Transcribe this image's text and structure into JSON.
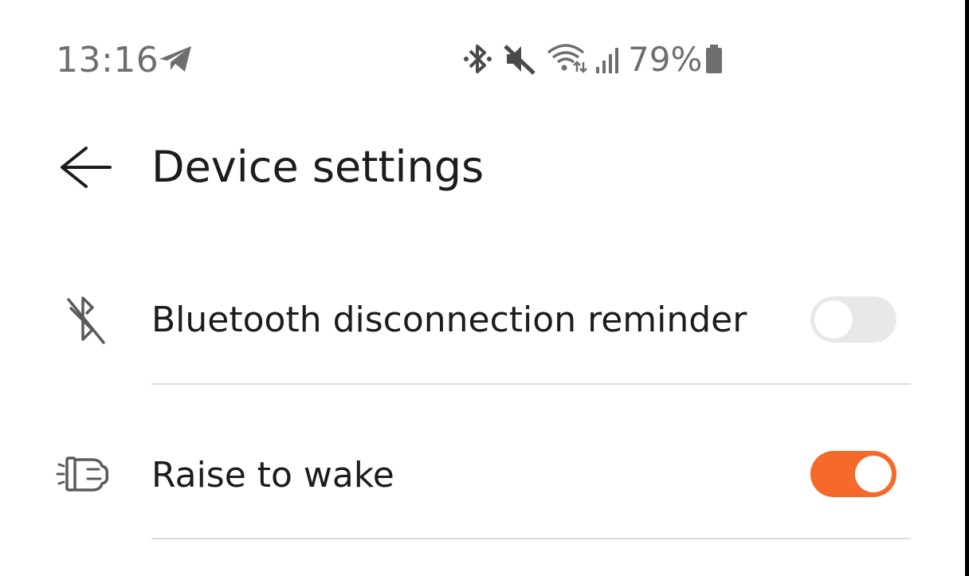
{
  "status_bar": {
    "time": "13:16",
    "battery_percent": "79%",
    "icons": [
      "telegram-icon",
      "bluetooth-icon",
      "mute-icon",
      "wifi-icon",
      "signal-icon",
      "battery-icon"
    ]
  },
  "header": {
    "title": "Device settings",
    "back_icon": "back-arrow-icon"
  },
  "settings": {
    "items": [
      {
        "label": "Bluetooth disconnection reminder",
        "icon": "bluetooth-off-icon",
        "enabled": false
      },
      {
        "label": "Raise to wake",
        "icon": "raise-to-wake-icon",
        "enabled": true
      }
    ]
  },
  "colors": {
    "accent": "#f56a2a",
    "toggle_off": "#e8e8e8",
    "text_primary": "#1c1c1c",
    "text_secondary": "#6e6e6e",
    "divider": "#dcdcdc"
  }
}
